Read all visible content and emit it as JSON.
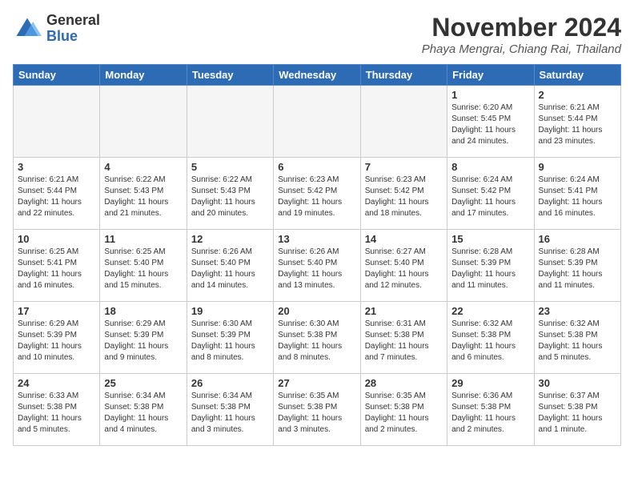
{
  "header": {
    "logo_general": "General",
    "logo_blue": "Blue",
    "month_title": "November 2024",
    "location": "Phaya Mengrai, Chiang Rai, Thailand"
  },
  "days_of_week": [
    "Sunday",
    "Monday",
    "Tuesday",
    "Wednesday",
    "Thursday",
    "Friday",
    "Saturday"
  ],
  "weeks": [
    [
      {
        "day": "",
        "empty": true
      },
      {
        "day": "",
        "empty": true
      },
      {
        "day": "",
        "empty": true
      },
      {
        "day": "",
        "empty": true
      },
      {
        "day": "",
        "empty": true
      },
      {
        "day": "1",
        "sunrise": "6:20 AM",
        "sunset": "5:45 PM",
        "daylight": "11 hours and 24 minutes."
      },
      {
        "day": "2",
        "sunrise": "6:21 AM",
        "sunset": "5:44 PM",
        "daylight": "11 hours and 23 minutes."
      }
    ],
    [
      {
        "day": "3",
        "sunrise": "6:21 AM",
        "sunset": "5:44 PM",
        "daylight": "11 hours and 22 minutes."
      },
      {
        "day": "4",
        "sunrise": "6:22 AM",
        "sunset": "5:43 PM",
        "daylight": "11 hours and 21 minutes."
      },
      {
        "day": "5",
        "sunrise": "6:22 AM",
        "sunset": "5:43 PM",
        "daylight": "11 hours and 20 minutes."
      },
      {
        "day": "6",
        "sunrise": "6:23 AM",
        "sunset": "5:42 PM",
        "daylight": "11 hours and 19 minutes."
      },
      {
        "day": "7",
        "sunrise": "6:23 AM",
        "sunset": "5:42 PM",
        "daylight": "11 hours and 18 minutes."
      },
      {
        "day": "8",
        "sunrise": "6:24 AM",
        "sunset": "5:42 PM",
        "daylight": "11 hours and 17 minutes."
      },
      {
        "day": "9",
        "sunrise": "6:24 AM",
        "sunset": "5:41 PM",
        "daylight": "11 hours and 16 minutes."
      }
    ],
    [
      {
        "day": "10",
        "sunrise": "6:25 AM",
        "sunset": "5:41 PM",
        "daylight": "11 hours and 16 minutes."
      },
      {
        "day": "11",
        "sunrise": "6:25 AM",
        "sunset": "5:40 PM",
        "daylight": "11 hours and 15 minutes."
      },
      {
        "day": "12",
        "sunrise": "6:26 AM",
        "sunset": "5:40 PM",
        "daylight": "11 hours and 14 minutes."
      },
      {
        "day": "13",
        "sunrise": "6:26 AM",
        "sunset": "5:40 PM",
        "daylight": "11 hours and 13 minutes."
      },
      {
        "day": "14",
        "sunrise": "6:27 AM",
        "sunset": "5:40 PM",
        "daylight": "11 hours and 12 minutes."
      },
      {
        "day": "15",
        "sunrise": "6:28 AM",
        "sunset": "5:39 PM",
        "daylight": "11 hours and 11 minutes."
      },
      {
        "day": "16",
        "sunrise": "6:28 AM",
        "sunset": "5:39 PM",
        "daylight": "11 hours and 11 minutes."
      }
    ],
    [
      {
        "day": "17",
        "sunrise": "6:29 AM",
        "sunset": "5:39 PM",
        "daylight": "11 hours and 10 minutes."
      },
      {
        "day": "18",
        "sunrise": "6:29 AM",
        "sunset": "5:39 PM",
        "daylight": "11 hours and 9 minutes."
      },
      {
        "day": "19",
        "sunrise": "6:30 AM",
        "sunset": "5:39 PM",
        "daylight": "11 hours and 8 minutes."
      },
      {
        "day": "20",
        "sunrise": "6:30 AM",
        "sunset": "5:38 PM",
        "daylight": "11 hours and 8 minutes."
      },
      {
        "day": "21",
        "sunrise": "6:31 AM",
        "sunset": "5:38 PM",
        "daylight": "11 hours and 7 minutes."
      },
      {
        "day": "22",
        "sunrise": "6:32 AM",
        "sunset": "5:38 PM",
        "daylight": "11 hours and 6 minutes."
      },
      {
        "day": "23",
        "sunrise": "6:32 AM",
        "sunset": "5:38 PM",
        "daylight": "11 hours and 5 minutes."
      }
    ],
    [
      {
        "day": "24",
        "sunrise": "6:33 AM",
        "sunset": "5:38 PM",
        "daylight": "11 hours and 5 minutes."
      },
      {
        "day": "25",
        "sunrise": "6:34 AM",
        "sunset": "5:38 PM",
        "daylight": "11 hours and 4 minutes."
      },
      {
        "day": "26",
        "sunrise": "6:34 AM",
        "sunset": "5:38 PM",
        "daylight": "11 hours and 3 minutes."
      },
      {
        "day": "27",
        "sunrise": "6:35 AM",
        "sunset": "5:38 PM",
        "daylight": "11 hours and 3 minutes."
      },
      {
        "day": "28",
        "sunrise": "6:35 AM",
        "sunset": "5:38 PM",
        "daylight": "11 hours and 2 minutes."
      },
      {
        "day": "29",
        "sunrise": "6:36 AM",
        "sunset": "5:38 PM",
        "daylight": "11 hours and 2 minutes."
      },
      {
        "day": "30",
        "sunrise": "6:37 AM",
        "sunset": "5:38 PM",
        "daylight": "11 hours and 1 minute."
      }
    ]
  ]
}
